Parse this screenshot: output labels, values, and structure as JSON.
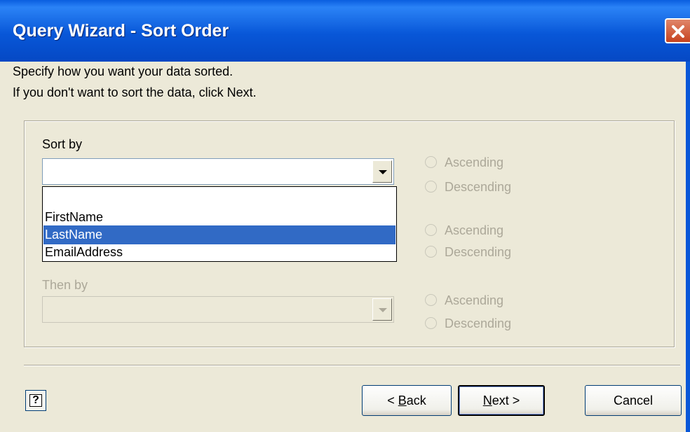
{
  "window": {
    "title": "Query Wizard - Sort Order"
  },
  "instructions": {
    "line1": "Specify how you want your data sorted.",
    "line2": "If you don't want to sort the data, click Next."
  },
  "sort_by": {
    "label": "Sort by",
    "value": "",
    "ascending_label": "Ascending",
    "descending_label": "Descending"
  },
  "dropdown": {
    "options": [
      "",
      "FirstName",
      "LastName",
      "EmailAddress"
    ],
    "selected": "LastName"
  },
  "then_by_1": {
    "ascending_label": "Ascending",
    "descending_label": "Descending"
  },
  "then_by_2": {
    "label": "Then by",
    "value": "",
    "ascending_label": "Ascending",
    "descending_label": "Descending"
  },
  "buttons": {
    "back_prefix": "< ",
    "back_mnemonic": "B",
    "back_rest": "ack",
    "next_mnemonic": "N",
    "next_rest": "ext >",
    "cancel": "Cancel",
    "help_glyph": "?"
  },
  "icons": {
    "close": "close-icon",
    "help": "help-icon",
    "dropdown_arrow": "chevron-down-icon"
  },
  "colors": {
    "title_bar": "#0857d8",
    "selection": "#316ac5",
    "close_button": "#c7431f",
    "dialog_bg": "#ece9d8"
  }
}
